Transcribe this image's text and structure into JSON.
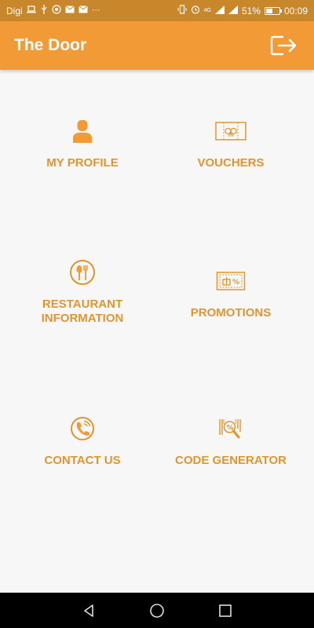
{
  "status_bar": {
    "carrier": "Digi",
    "network": "4G",
    "battery_percent": "51%",
    "battery_level": 0.51,
    "time": "00:09"
  },
  "app_bar": {
    "title": "The Door",
    "logout_icon": "logout-icon"
  },
  "menu": {
    "my_profile": {
      "label": "MY PROFILE",
      "icon": "person-icon"
    },
    "vouchers": {
      "label": "VOUCHERS",
      "icon": "voucher-icon"
    },
    "restaurant_information": {
      "label": "RESTAURANT\nINFORMATION",
      "icon": "restaurant-icon"
    },
    "promotions": {
      "label": "PROMOTIONS",
      "icon": "promotion-ticket-icon"
    },
    "contact_us": {
      "label": "CONTACT US",
      "icon": "phone-icon"
    },
    "code_generator": {
      "label": "CODE GENERATOR",
      "icon": "barcode-scan-icon"
    }
  },
  "colors": {
    "accent": "#f19a36",
    "label": "#e0962f",
    "status_bar": "#c8872b"
  }
}
